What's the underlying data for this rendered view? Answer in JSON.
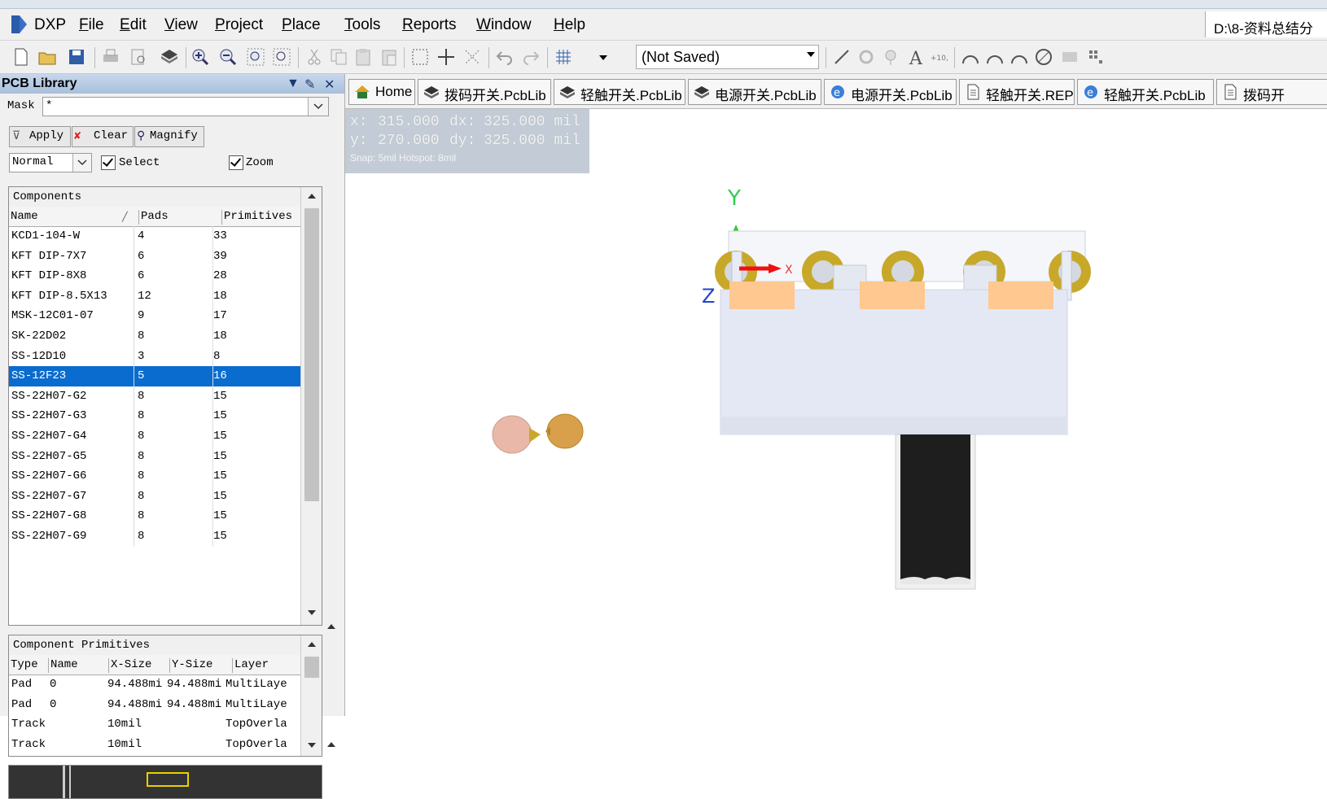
{
  "menu": {
    "app": "DXP",
    "items": [
      "File",
      "Edit",
      "View",
      "Project",
      "Place",
      "Tools",
      "Reports",
      "Window",
      "Help"
    ],
    "path": "D:\\8-资料总结分"
  },
  "toolbar": {
    "project_combo": "(Not Saved)"
  },
  "panel": {
    "title": "PCB Library",
    "mask_label": "Mask",
    "mask_value": "*",
    "apply": "Apply",
    "clear": "Clear",
    "magnify": "Magnify",
    "mode": "Normal",
    "select_label": "Select",
    "zoom_label": "Zoom",
    "components": {
      "caption": "Components",
      "headers": [
        "Name",
        "Pads",
        "Primitives"
      ],
      "rows": [
        {
          "name": "KCD1-104-W",
          "pads": "4",
          "prims": "33"
        },
        {
          "name": "KFT DIP-7X7",
          "pads": "6",
          "prims": "39"
        },
        {
          "name": "KFT DIP-8X8",
          "pads": "6",
          "prims": "28"
        },
        {
          "name": "KFT DIP-8.5X13",
          "pads": "12",
          "prims": "18"
        },
        {
          "name": "MSK-12C01-07",
          "pads": "9",
          "prims": "17"
        },
        {
          "name": "SK-22D02",
          "pads": "8",
          "prims": "18"
        },
        {
          "name": "SS-12D10",
          "pads": "3",
          "prims": "8"
        },
        {
          "name": "SS-12F23",
          "pads": "5",
          "prims": "16"
        },
        {
          "name": "SS-22H07-G2",
          "pads": "8",
          "prims": "15"
        },
        {
          "name": "SS-22H07-G3",
          "pads": "8",
          "prims": "15"
        },
        {
          "name": "SS-22H07-G4",
          "pads": "8",
          "prims": "15"
        },
        {
          "name": "SS-22H07-G5",
          "pads": "8",
          "prims": "15"
        },
        {
          "name": "SS-22H07-G6",
          "pads": "8",
          "prims": "15"
        },
        {
          "name": "SS-22H07-G7",
          "pads": "8",
          "prims": "15"
        },
        {
          "name": "SS-22H07-G8",
          "pads": "8",
          "prims": "15"
        },
        {
          "name": "SS-22H07-G9",
          "pads": "8",
          "prims": "15"
        }
      ],
      "selected_index": 7
    },
    "primitives": {
      "caption": "Component Primitives",
      "headers": [
        "Type",
        "Name",
        "X-Size",
        "Y-Size",
        "Layer"
      ],
      "rows": [
        {
          "type": "Pad",
          "name": "0",
          "x": "94.488mi",
          "y": "94.488mi",
          "layer": "MultiLaye"
        },
        {
          "type": "Pad",
          "name": "0",
          "x": "94.488mi",
          "y": "94.488mi",
          "layer": "MultiLaye"
        },
        {
          "type": "Track",
          "name": "",
          "x": "10mil",
          "y": "",
          "layer": "TopOverla"
        },
        {
          "type": "Track",
          "name": "",
          "x": "10mil",
          "y": "",
          "layer": "TopOverla"
        }
      ]
    }
  },
  "tabs": [
    {
      "label": "Home",
      "icon": "home-icon"
    },
    {
      "label": "拨码开关.PcbLib",
      "icon": "pcblib-icon"
    },
    {
      "label": "轻触开关.PcbLib",
      "icon": "pcblib-icon"
    },
    {
      "label": "电源开关.PcbLib",
      "icon": "pcblib-icon"
    },
    {
      "label": "电源开关.PcbLib",
      "icon": "ie-icon"
    },
    {
      "label": "轻触开关.REP",
      "icon": "document-icon"
    },
    {
      "label": "轻触开关.PcbLib",
      "icon": "ie-icon"
    },
    {
      "label": "拨码开",
      "icon": "document-icon"
    }
  ],
  "coords": {
    "x_label": "x:",
    "x_value": "315.000",
    "dx_label": "dx:",
    "dx_value": "325.000 mil",
    "y_label": "y:",
    "y_value": "270.000",
    "dy_label": "dy:",
    "dy_value": "325.000 mil",
    "snap": "Snap: 5mil Hotspot: 8mil"
  },
  "axes": {
    "y": "Y",
    "x": "X",
    "z": "Z"
  },
  "colors": {
    "pad_gold": "#c8a829",
    "pad_orange": "#ffc890",
    "body": "#e4e8f4",
    "knob": "#1e1e1e",
    "selection": "#0a6ccf"
  }
}
